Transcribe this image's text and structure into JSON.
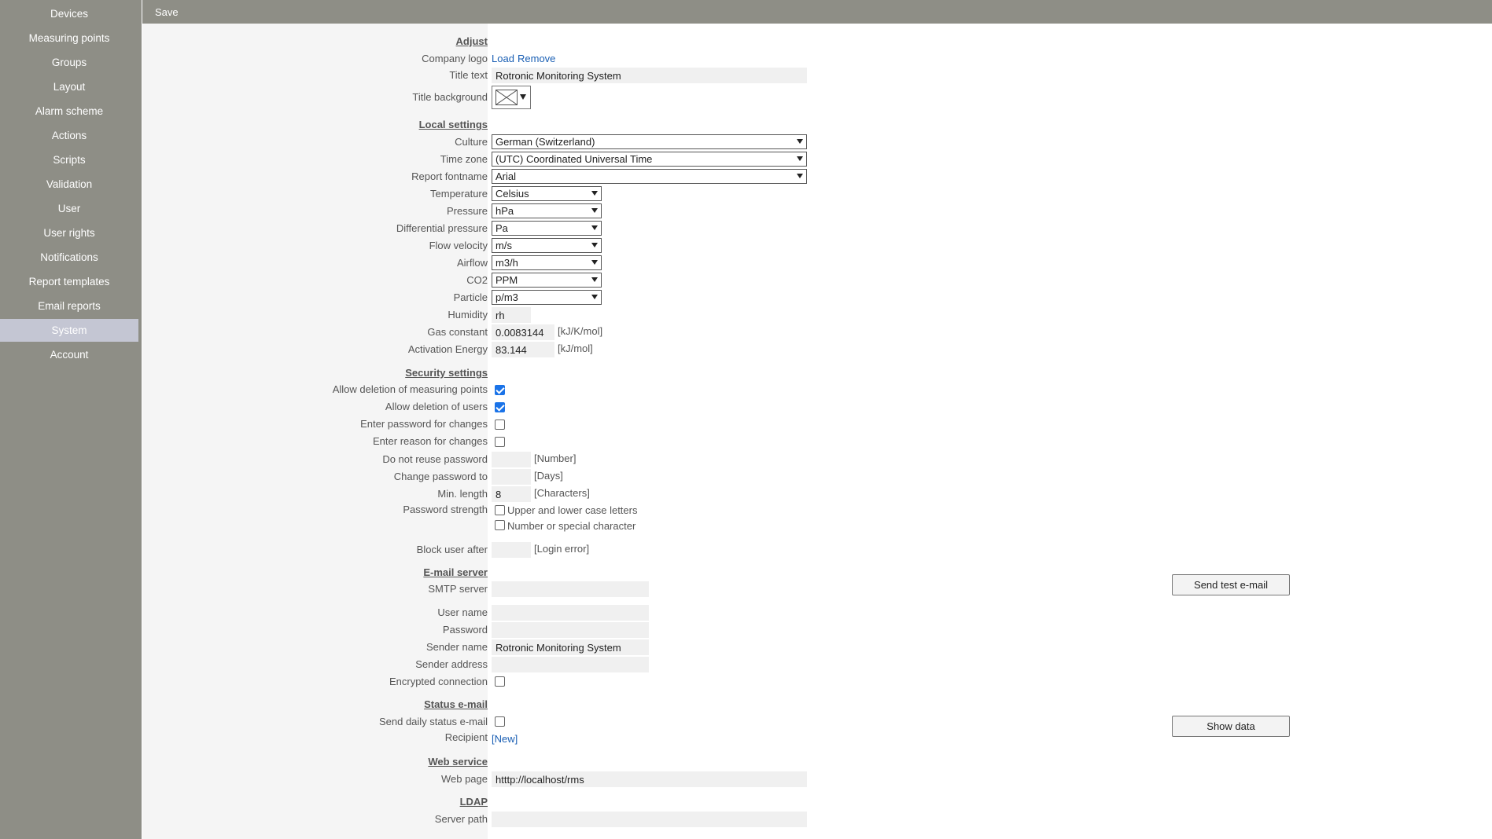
{
  "sidebar": {
    "items": [
      {
        "label": "Devices"
      },
      {
        "label": "Measuring points"
      },
      {
        "label": "Groups"
      },
      {
        "label": "Layout"
      },
      {
        "label": "Alarm scheme"
      },
      {
        "label": "Actions"
      },
      {
        "label": "Scripts"
      },
      {
        "label": "Validation"
      },
      {
        "label": "User"
      },
      {
        "label": "User rights"
      },
      {
        "label": "Notifications"
      },
      {
        "label": "Report templates"
      },
      {
        "label": "Email reports"
      },
      {
        "label": "System"
      },
      {
        "label": "Account"
      }
    ]
  },
  "toolbar": {
    "save_label": "Save"
  },
  "adjust": {
    "heading": "Adjust",
    "company_logo_label": "Company logo",
    "load_link": "Load",
    "remove_link": "Remove",
    "title_text_label": "Title text",
    "title_text_value": "Rotronic Monitoring System",
    "title_background_label": "Title background"
  },
  "local": {
    "heading": "Local settings",
    "culture_label": "Culture",
    "culture_value": "German (Switzerland)",
    "timezone_label": "Time zone",
    "timezone_value": "(UTC) Coordinated Universal Time",
    "fontname_label": "Report fontname",
    "fontname_value": "Arial",
    "temperature_label": "Temperature",
    "temperature_value": "Celsius",
    "pressure_label": "Pressure",
    "pressure_value": "hPa",
    "diff_pressure_label": "Differential pressure",
    "diff_pressure_value": "Pa",
    "flow_velocity_label": "Flow velocity",
    "flow_velocity_value": "m/s",
    "airflow_label": "Airflow",
    "airflow_value": "m3/h",
    "co2_label": "CO2",
    "co2_value": "PPM",
    "particle_label": "Particle",
    "particle_value": "p/m3",
    "humidity_label": "Humidity",
    "humidity_value": "rh",
    "gas_constant_label": "Gas constant",
    "gas_constant_value": "0.0083144",
    "gas_constant_unit": "[kJ/K/mol]",
    "activation_energy_label": "Activation Energy",
    "activation_energy_value": "83.144",
    "activation_energy_unit": "[kJ/mol]"
  },
  "security": {
    "heading": "Security settings",
    "allow_del_mp_label": "Allow deletion of measuring points",
    "allow_del_users_label": "Allow deletion of users",
    "enter_password_label": "Enter password for changes",
    "enter_reason_label": "Enter reason for changes",
    "no_reuse_label": "Do not reuse password",
    "no_reuse_unit": "[Number]",
    "no_reuse_value": "",
    "change_pw_label": "Change password to",
    "change_pw_unit": "[Days]",
    "change_pw_value": "",
    "min_length_label": "Min. length",
    "min_length_value": "8",
    "min_length_unit": "[Characters]",
    "pw_strength_label": "Password strength",
    "upper_lower_label": "Upper and lower case letters",
    "number_special_label": "Number or special character",
    "block_user_label": "Block user after",
    "block_user_unit": "[Login error]",
    "block_user_value": ""
  },
  "email": {
    "heading": "E-mail server",
    "smtp_label": "SMTP server",
    "smtp_value": "",
    "user_label": "User name",
    "user_value": "",
    "password_label": "Password",
    "password_value": "",
    "sender_name_label": "Sender name",
    "sender_name_value": "Rotronic Monitoring System",
    "sender_address_label": "Sender address",
    "sender_address_value": "",
    "encrypted_label": "Encrypted connection",
    "test_button": "Send test e-mail"
  },
  "status_email": {
    "heading": "Status e-mail",
    "daily_label": "Send daily status e-mail",
    "recipient_label": "Recipient",
    "new_link": "[New]",
    "show_data_button": "Show data"
  },
  "web": {
    "heading": "Web service",
    "page_label": "Web page",
    "page_value": "htttp://localhost/rms"
  },
  "ldap": {
    "heading": "LDAP",
    "server_path_label": "Server path",
    "server_path_value": ""
  },
  "colors": {
    "sidebar_bg": "#8e8e86",
    "active_item": "#c4c6d3",
    "link": "#1a5fb4",
    "checkbox_on": "#1a73e8"
  }
}
